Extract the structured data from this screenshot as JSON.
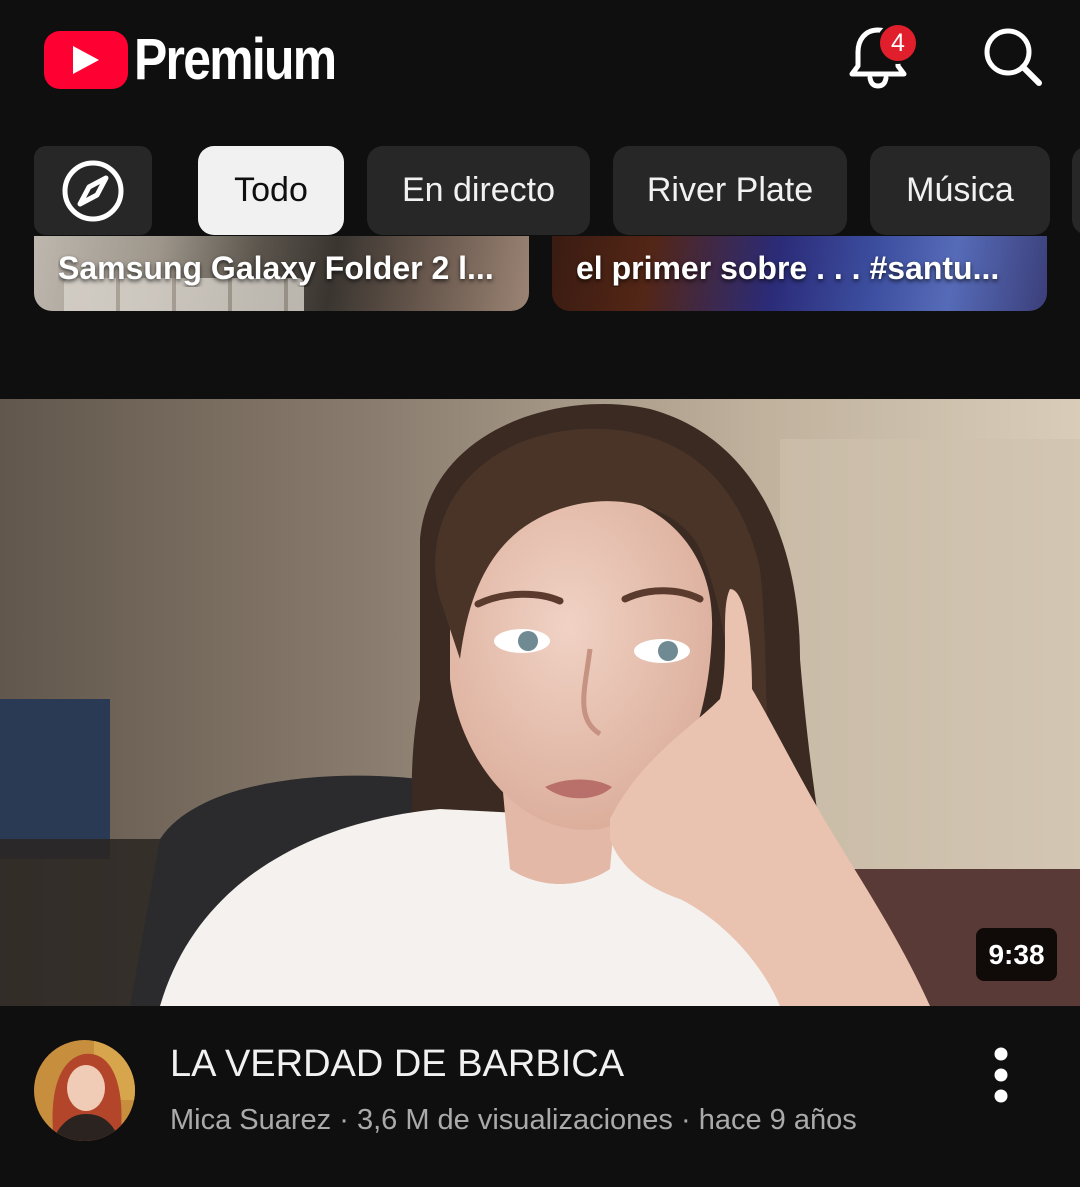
{
  "header": {
    "brand_text": "Premium",
    "notification_count": "4",
    "icons": [
      "youtube-play-icon",
      "bell-icon",
      "search-icon"
    ]
  },
  "chips": {
    "explore_icon": "compass-icon",
    "items": [
      {
        "label": "Todo",
        "selected": true
      },
      {
        "label": "En directo",
        "selected": false
      },
      {
        "label": "River Plate",
        "selected": false
      },
      {
        "label": "Música",
        "selected": false
      }
    ]
  },
  "shorts": [
    {
      "title": "Samsung Galaxy Folder 2 l..."
    },
    {
      "title": "el primer sobre . . . #santu..."
    }
  ],
  "video": {
    "duration": "9:38",
    "title": "LA VERDAD DE BARBICA",
    "channel": "Mica Suarez",
    "views": "3,6 M de visualizaciones",
    "age": "hace 9 años",
    "separator": "·",
    "menu_icon": "more-vert-icon"
  },
  "colors": {
    "background": "#0f0f0f",
    "brand_red": "#ff0033",
    "badge_red": "#e01e2c",
    "chip_bg": "#272727",
    "chip_active_bg": "#f1f1f1",
    "secondary_text": "#aaaaaa"
  }
}
